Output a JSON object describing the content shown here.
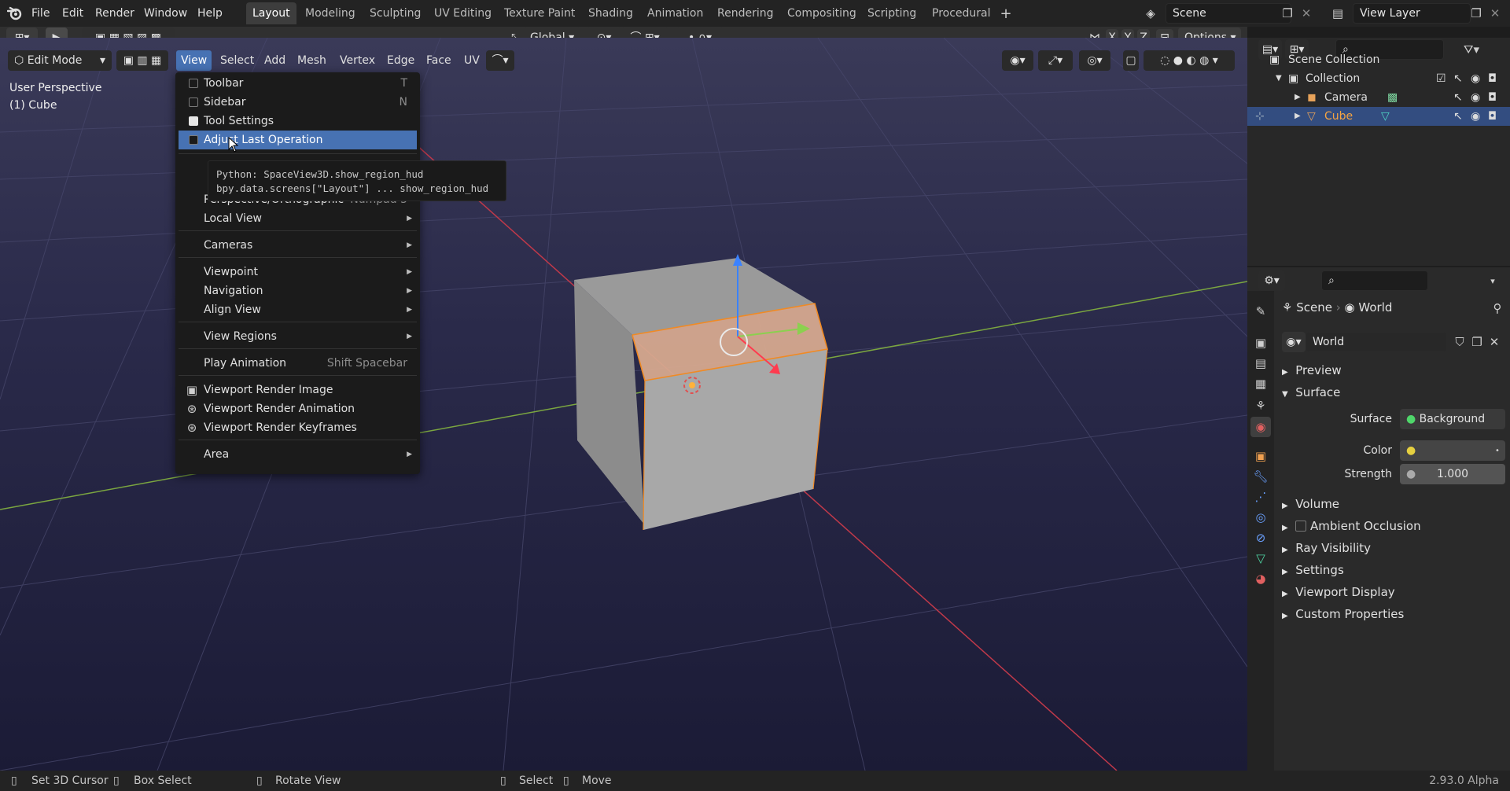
{
  "topbar": {
    "menus": [
      "File",
      "Edit",
      "Render",
      "Window",
      "Help"
    ],
    "workspaces": [
      "Layout",
      "Modeling",
      "Sculpting",
      "UV Editing",
      "Texture Paint",
      "Shading",
      "Animation",
      "Rendering",
      "Compositing",
      "Scripting",
      "Procedural"
    ],
    "active_workspace": "Layout",
    "scene": "Scene",
    "view_layer": "View Layer"
  },
  "tool_header": {
    "orientation": "Global",
    "options": "Options",
    "axes": [
      "X",
      "Y",
      "Z"
    ]
  },
  "editor_header": {
    "mode": "Edit Mode",
    "menus": [
      "View",
      "Select",
      "Add",
      "Mesh",
      "Vertex",
      "Edge",
      "Face",
      "UV"
    ],
    "active_menu": "View"
  },
  "viewport": {
    "perspective": "User Perspective",
    "object": "(1) Cube"
  },
  "view_menu": {
    "items": [
      {
        "label": "Toolbar",
        "shortcut": "T",
        "checked": false
      },
      {
        "label": "Sidebar",
        "shortcut": "N",
        "checked": false
      },
      {
        "label": "Tool Settings",
        "shortcut": "",
        "checked": true
      },
      {
        "label": "Adjust Last Operation",
        "shortcut": "",
        "checked": false
      },
      {
        "label": "Perspective/Orthographic",
        "shortcut": "Numpad 5"
      },
      {
        "label": "Local View"
      },
      {
        "label": "Cameras"
      },
      {
        "label": "Viewpoint"
      },
      {
        "label": "Navigation"
      },
      {
        "label": "Align View"
      },
      {
        "label": "View Regions"
      },
      {
        "label": "Play Animation",
        "shortcut": "Shift Spacebar"
      },
      {
        "label": "Viewport Render Image"
      },
      {
        "label": "Viewport Render Animation"
      },
      {
        "label": "Viewport Render Keyframes"
      },
      {
        "label": "Area"
      }
    ]
  },
  "tooltip": {
    "line1": "Python: SpaceView3D.show_region_hud",
    "line2": "bpy.data.screens[\"Layout\"] ... show_region_hud"
  },
  "outliner": {
    "root": "Scene Collection",
    "collection": "Collection",
    "objects": [
      "Camera",
      "Cube"
    ]
  },
  "properties": {
    "breadcrumb": [
      "Scene",
      "World"
    ],
    "world_name": "World",
    "panels": {
      "preview": "Preview",
      "surface": "Surface",
      "volume": "Volume",
      "ao": "Ambient Occlusion",
      "ray": "Ray Visibility",
      "settings": "Settings",
      "display": "Viewport Display",
      "custom": "Custom Properties"
    },
    "surface_label": "Surface",
    "surface_value": "Background",
    "color_label": "Color",
    "strength_label": "Strength",
    "strength_value": "1.000"
  },
  "statusbar": {
    "items": [
      "Set 3D Cursor",
      "Box Select",
      "Rotate View",
      "Select",
      "Move"
    ],
    "version": "2.93.0 Alpha"
  },
  "colors": {
    "accent": "#4772b3",
    "active_object": "#f5a442",
    "background": "#1d1d1d"
  }
}
